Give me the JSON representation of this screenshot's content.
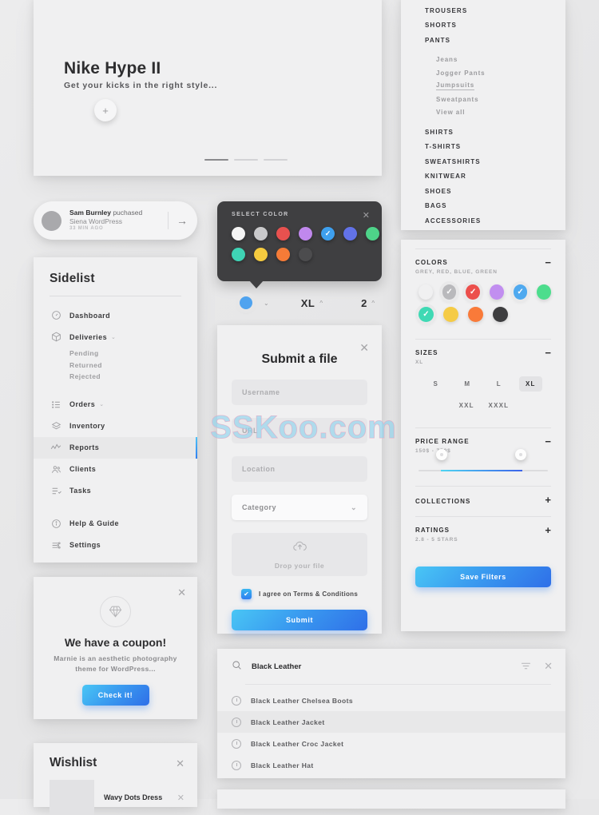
{
  "hero": {
    "title": "Nike Hype II",
    "subtitle": "Get your kicks in the right style...",
    "add_icon": "+",
    "slides": 3,
    "active_slide": 1
  },
  "notification": {
    "user": "Sam Burnley",
    "action": " puchased",
    "item": "Siena WordPress",
    "time": "33 MIN AGO",
    "arrow": "→"
  },
  "sidelist": {
    "title": "Sidelist",
    "items": [
      {
        "label": "Dashboard",
        "icon": "gauge-icon",
        "chevron": "",
        "active": false
      },
      {
        "label": "Deliveries",
        "icon": "box-icon",
        "chevron": "⌄",
        "active": false
      },
      {
        "label": "Orders",
        "icon": "list-icon",
        "chevron": "⌄",
        "active": false
      },
      {
        "label": "Inventory",
        "icon": "layers-icon",
        "chevron": "",
        "active": false
      },
      {
        "label": "Reports",
        "icon": "chart-line-icon",
        "chevron": "",
        "active": true
      },
      {
        "label": "Clients",
        "icon": "users-icon",
        "chevron": "",
        "active": false
      },
      {
        "label": "Tasks",
        "icon": "tasks-icon",
        "chevron": "",
        "active": false
      },
      {
        "label": "Help & Guide",
        "icon": "info-icon",
        "chevron": "",
        "active": false
      },
      {
        "label": "Settings",
        "icon": "sliders-icon",
        "chevron": "",
        "active": false
      }
    ],
    "sub_items": [
      "Pending",
      "Returned",
      "Rejected"
    ]
  },
  "coupon": {
    "title": "We have a coupon!",
    "text": "Marnie is an aesthetic photography theme for WordPress...",
    "button": "Check it!",
    "close": "✕",
    "icon": "diamond-icon"
  },
  "wishlist": {
    "title": "Wishlist",
    "close": "✕",
    "items": [
      {
        "name": "Wavy Dots Dress",
        "remove": "✕"
      }
    ]
  },
  "color_picker": {
    "header": "SELECT COLOR",
    "close": "✕",
    "row1": [
      {
        "name": "white",
        "hex": "#f4f4f4",
        "checked": false
      },
      {
        "name": "silver",
        "hex": "#c9c9cb",
        "checked": false
      },
      {
        "name": "red",
        "hex": "#e8514f",
        "checked": false
      },
      {
        "name": "purple",
        "hex": "#c088ed",
        "checked": false
      },
      {
        "name": "blue",
        "hex": "#3ea0ef",
        "checked": true
      },
      {
        "name": "indigo",
        "hex": "#6272e8",
        "checked": false
      },
      {
        "name": "green",
        "hex": "#4ed389",
        "checked": false
      }
    ],
    "row2": [
      {
        "name": "teal",
        "hex": "#3fd3b5",
        "checked": false
      },
      {
        "name": "yellow",
        "hex": "#f5cb3f",
        "checked": false
      },
      {
        "name": "orange",
        "hex": "#f57b37",
        "checked": false
      },
      {
        "name": "charcoal",
        "hex": "#4c4c4e",
        "checked": false
      }
    ]
  },
  "product_controls": {
    "color_hex": "#4fa3ef",
    "color_chevron": "⌄",
    "size": "XL",
    "size_chevron": "^",
    "quantity": "2",
    "quantity_chevron": "^"
  },
  "submit_form": {
    "title": "Submit a file",
    "close": "✕",
    "fields": [
      {
        "name": "username",
        "placeholder": "Username"
      },
      {
        "name": "url",
        "placeholder": "URL"
      },
      {
        "name": "location",
        "placeholder": "Location"
      }
    ],
    "category": {
      "placeholder": "Category",
      "chevron": "⌄"
    },
    "dropzone": {
      "text": "Drop your file",
      "icon": "cloud-upload-icon"
    },
    "terms": {
      "label": "I agree on Terms & Conditions",
      "checked": true,
      "check": "✔"
    },
    "submit": "Submit"
  },
  "right_nav": {
    "categories": [
      "TROUSERS",
      "SHORTS",
      "PANTS"
    ],
    "pants_sub": [
      "Jeans",
      "Jogger Pants",
      "Jumpsuits",
      "Sweatpants",
      "View all"
    ],
    "active_sub": "Jumpsuits",
    "more": [
      "SHIRTS",
      "T-SHIRTS",
      "SWEATSHIRTS",
      "KNITWEAR",
      "SHOES",
      "BAGS",
      "ACCESSORIES"
    ]
  },
  "filters": {
    "colors": {
      "title": "COLORS",
      "summary": "GREY, RED, BLUE, GREEN",
      "toggle": "−",
      "row1": [
        {
          "name": "white",
          "hex": "#f0f0f1",
          "selected": false
        },
        {
          "name": "grey",
          "hex": "#b9b9bc",
          "selected": true
        },
        {
          "name": "red",
          "hex": "#ec4f4c",
          "selected": true
        },
        {
          "name": "purple",
          "hex": "#c18ef0",
          "selected": false
        },
        {
          "name": "blue",
          "hex": "#4fa9ef",
          "selected": true
        },
        {
          "name": "green",
          "hex": "#4ddd8d",
          "selected": false
        }
      ],
      "row2": [
        {
          "name": "teal",
          "hex": "#3fd9b4",
          "selected": true
        },
        {
          "name": "yellow",
          "hex": "#f5cb45",
          "selected": false
        },
        {
          "name": "orange",
          "hex": "#f97a39",
          "selected": false
        },
        {
          "name": "charcoal",
          "hex": "#3d3d3f",
          "selected": false
        }
      ]
    },
    "sizes": {
      "title": "SIZES",
      "summary": "XL",
      "toggle": "−",
      "row1": [
        "S",
        "M",
        "L",
        "XL"
      ],
      "row2": [
        "",
        "XXL",
        "XXXL",
        ""
      ],
      "selected": "XL"
    },
    "price": {
      "title": "PRICE RANGE",
      "summary": "150$ - 750$",
      "toggle": "−",
      "min": 150,
      "max": 750
    },
    "collections": {
      "title": "COLLECTIONS",
      "summary": "",
      "toggle": "+"
    },
    "ratings": {
      "title": "RATINGS",
      "summary": "2.8 - 5 STARS",
      "toggle": "+"
    },
    "save_button": "Save Filters"
  },
  "search": {
    "value": "Black Leather",
    "search_icon": "search-icon",
    "filter_icon": "filter-icon",
    "close": "✕",
    "results": [
      {
        "text": "Black Leather Chelsea Boots",
        "highlighted": false
      },
      {
        "text": "Black Leather Jacket",
        "highlighted": true
      },
      {
        "text": "Black Leather Croc Jacket",
        "highlighted": false
      },
      {
        "text": "Black Leather Hat",
        "highlighted": false
      }
    ]
  },
  "watermark": {
    "text": "SSKoo.com"
  }
}
